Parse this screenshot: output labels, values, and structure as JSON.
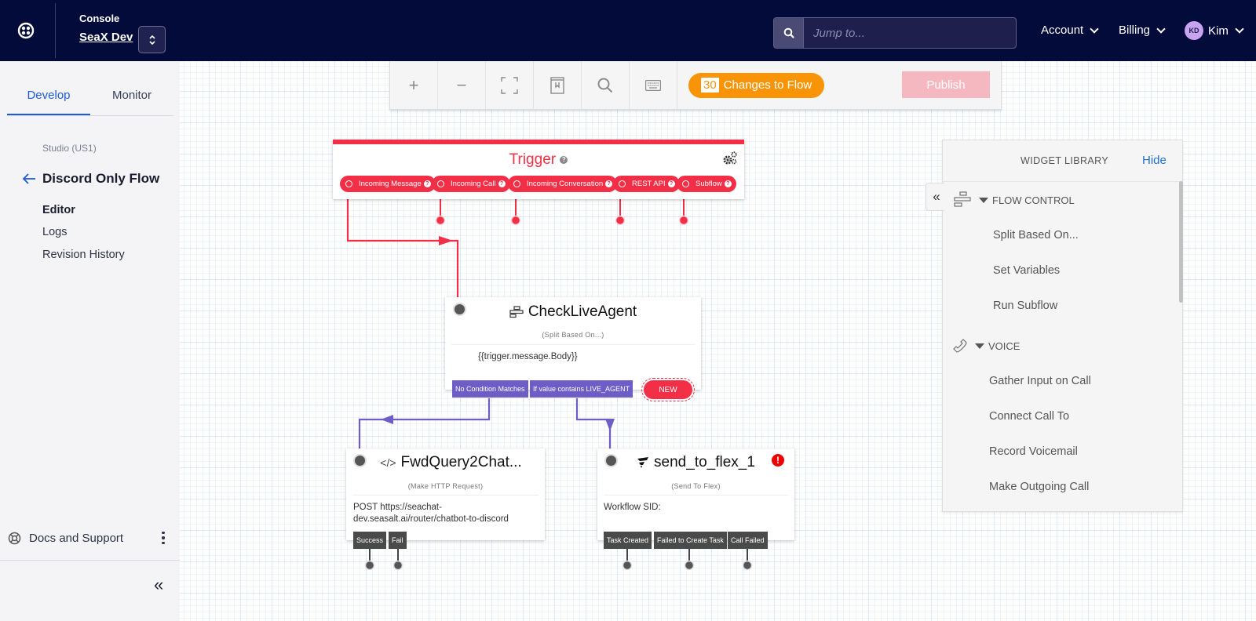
{
  "topbar": {
    "console_label": "Console",
    "account_name": "SeaX Dev",
    "search_placeholder": "Jump to...",
    "menus": {
      "account": "Account",
      "billing": "Billing",
      "user_initials": "KD",
      "user_name": "Kim"
    }
  },
  "sidebar": {
    "tabs": [
      {
        "label": "Develop",
        "active": true
      },
      {
        "label": "Monitor",
        "active": false
      }
    ],
    "section_label": "Studio (US1)",
    "flow_title": "Discord Only Flow",
    "nav": [
      {
        "label": "Editor",
        "active": true
      },
      {
        "label": "Logs",
        "active": false
      },
      {
        "label": "Revision History",
        "active": false
      }
    ],
    "docs_label": "Docs and Support",
    "collapse_label": "«"
  },
  "toolbar": {
    "tools": [
      "zoom-in",
      "zoom-out",
      "fit-to-screen",
      "notes",
      "search",
      "keyboard-shortcuts"
    ],
    "changes_count": "30",
    "changes_label": "Changes to Flow",
    "publish_label": "Publish"
  },
  "flow": {
    "trigger": {
      "title": "Trigger",
      "help": "?",
      "events": [
        "Incoming Message",
        "Incoming Call",
        "Incoming Conversation",
        "REST API",
        "Subflow"
      ]
    },
    "check_live_agent": {
      "title": "CheckLiveAgent",
      "type": "(Split Based On...)",
      "body": "{{trigger.message.Body}}",
      "transitions": [
        "No Condition Matches",
        "If value contains LIVE_AGENT"
      ],
      "new_label": "NEW"
    },
    "fwd_query": {
      "title": "FwdQuery2Chat...",
      "type": "(Make HTTP Request)",
      "body_line1": "POST https://seachat-",
      "body_line2": "dev.seasalt.ai/router/chatbot-to-discord",
      "transitions": [
        "Success",
        "Fail"
      ]
    },
    "send_to_flex": {
      "title": "send_to_flex_1",
      "type": "(Send To Flex)",
      "body": "Workflow SID:",
      "error": "!",
      "transitions": [
        "Task Created",
        "Failed to Create Task",
        "Call Failed"
      ]
    }
  },
  "widget_library": {
    "title": "WIDGET LIBRARY",
    "hide_label": "Hide",
    "collapse_label": "«",
    "categories": [
      {
        "label": "FLOW CONTROL",
        "items": [
          "Split Based On...",
          "Set Variables",
          "Run Subflow"
        ]
      },
      {
        "label": "VOICE",
        "items": [
          "Gather Input on Call",
          "Connect Call To",
          "Record Voicemail",
          "Make Outgoing Call"
        ]
      }
    ]
  },
  "colors": {
    "topbar": "#030b3a",
    "accent_red": "#f22f46",
    "transition_purple": "#6e5dc6",
    "changes_orange": "#f89406",
    "publish_disabled": "#f6b8c0",
    "link_blue": "#1d5cd9"
  }
}
